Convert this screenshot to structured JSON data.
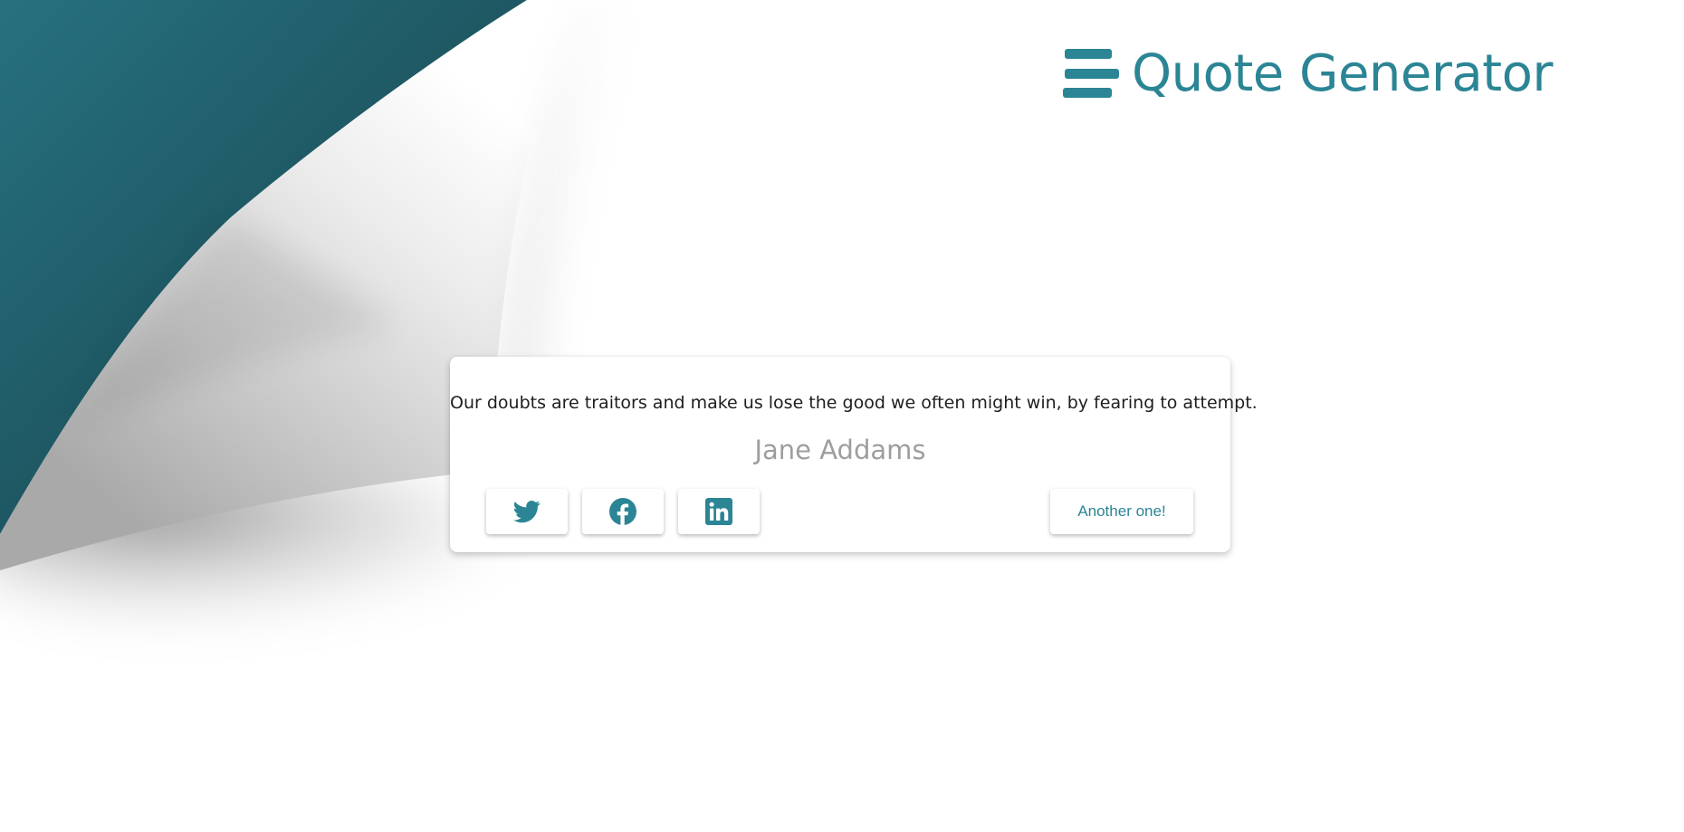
{
  "header": {
    "title": "Quote Generator",
    "icon": "bars-icon"
  },
  "quote": {
    "text": "Our doubts are traitors and make us lose the good we often might win, by fearing to attempt.",
    "author": "Jane Addams"
  },
  "share": {
    "buttons": [
      {
        "icon": "twitter-icon"
      },
      {
        "icon": "facebook-icon"
      },
      {
        "icon": "linkedin-icon"
      }
    ]
  },
  "actions": {
    "next_label": "Another one!"
  },
  "colors": {
    "accent": "#2b8595",
    "curl_dark": "#1b4f59",
    "curl_light": "#2a6f7e",
    "author_gray": "#9e9e9e"
  }
}
